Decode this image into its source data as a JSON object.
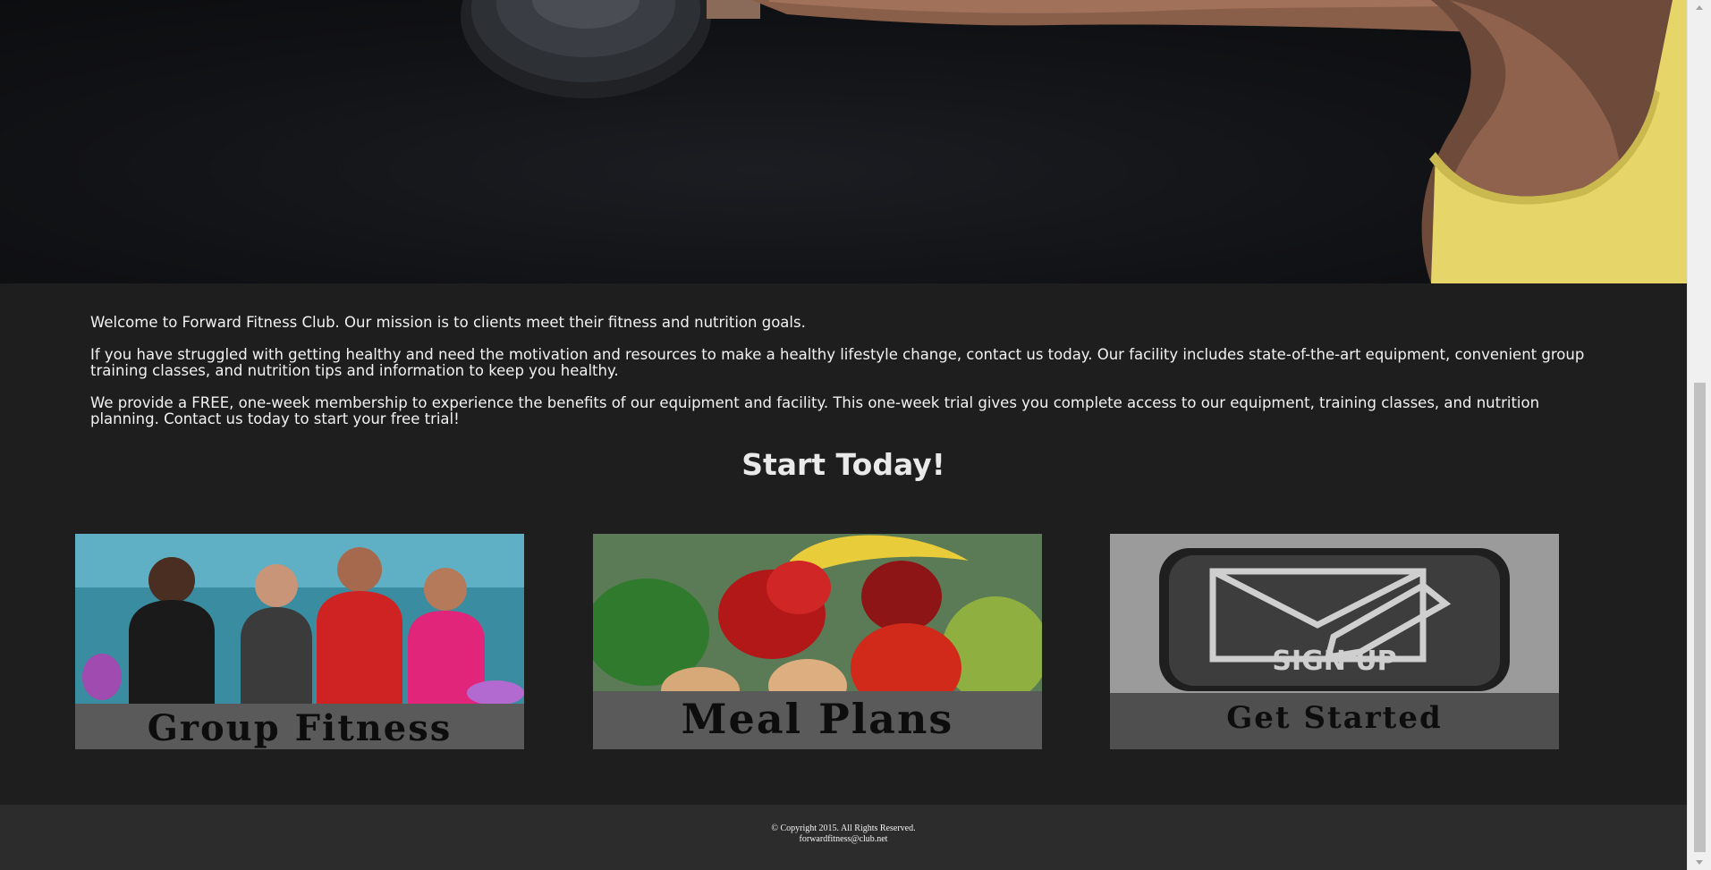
{
  "main": {
    "paragraphs": [
      "Welcome to Forward Fitness Club. Our mission is to clients meet their fitness and nutrition goals.",
      "If you have struggled with getting healthy and need the motivation and resources to make a healthy lifestyle change, contact us today. Our facility includes state-of-the-art equipment, convenient group training classes, and nutrition tips and information to keep you healthy.",
      "We provide a FREE, one-week membership to experience the benefits of our equipment and facility. This one-week trial gives you complete access to our equipment, training classes, and nutrition planning. Contact us today to start your free trial!"
    ],
    "cta_heading": "Start Today!"
  },
  "cards": [
    {
      "label": "Group Fitness"
    },
    {
      "label": "Meal Plans"
    },
    {
      "label": "Get Started",
      "sign_text": "SIGN UP"
    }
  ],
  "footer": {
    "copyright": "© Copyright 2015. All Rights Reserved.",
    "email": "forwardfitness@club.net"
  },
  "colors": {
    "background": "#1e1e1e",
    "footer": "#2c2c2c",
    "text": "#f2f2f2"
  }
}
